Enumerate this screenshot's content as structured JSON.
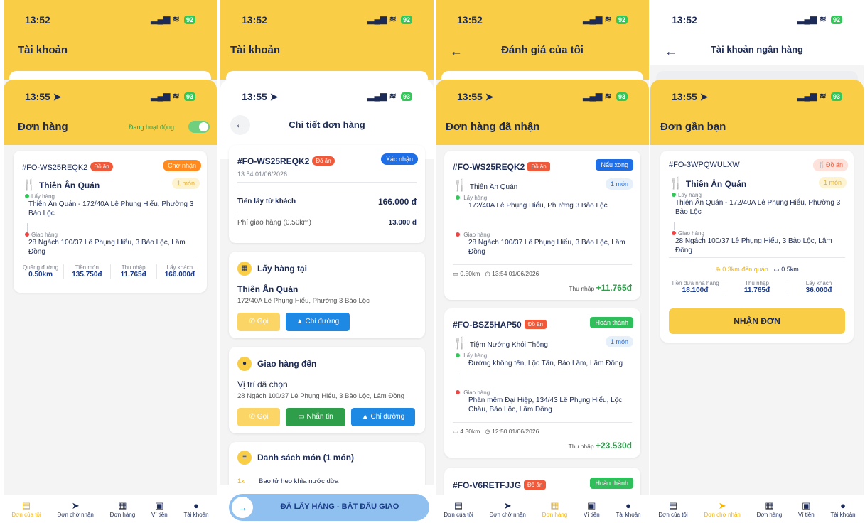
{
  "p1": {
    "bg_time": "13:52",
    "bg_title": "Tài khoản",
    "time": "13:55",
    "battery_bg": "92",
    "battery": "93",
    "title": "Đơn hàng",
    "toggle_label": "Đang hoạt động",
    "order": {
      "code": "#FO-WS25REQK2",
      "tag": "Đồ ăn",
      "status": "Chờ nhận",
      "restaurant": "Thiên Ân Quán",
      "items": "1 món",
      "pickup_label": "Lấy hàng",
      "pickup": "Thiên Ân Quán - 172/40A Lê Phụng Hiểu, Phường 3 Bảo Lộc",
      "delivery_label": "Giao hàng",
      "delivery": "28 Ngách 100/37 Lê Phụng Hiểu, 3 Bảo Lộc, Lâm Đồng",
      "stats": [
        {
          "label": "Quãng đường",
          "value": "0.50km"
        },
        {
          "label": "Tiền món",
          "value": "135.750đ"
        },
        {
          "label": "Thu nhập",
          "value": "11.765đ"
        },
        {
          "label": "Lấy khách",
          "value": "166.000đ"
        }
      ]
    }
  },
  "p2": {
    "bg_time": "13:52",
    "bg_title": "Tài khoản",
    "time": "13:55",
    "title": "Chi tiết đơn hàng",
    "code": "#FO-WS25REQK2",
    "tag": "Đồ ăn",
    "confirm": "Xác nhận",
    "datetime": "13:54 01/06/2026",
    "collect_label": "Tiền lấy từ khách",
    "collect_value": "166.000 đ",
    "fee_label": "Phí giao hàng (0.50km)",
    "fee_value": "13.000 đ",
    "pickup_section": "Lấy hàng tại",
    "pickup_name": "Thiên Ân Quán",
    "pickup_addr": "172/40A Lê Phụng Hiểu, Phường 3 Bảo Lộc",
    "call": "Gọi",
    "directions": "Chỉ đường",
    "delivery_section": "Giao hàng đến",
    "delivery_name": "Vị trí đã chọn",
    "delivery_addr": "28 Ngách 100/37 Lê Phụng Hiểu, 3 Bảo Lộc, Lâm Đồng",
    "message": "Nhắn tin",
    "list_section": "Danh sách món (1 món)",
    "item_qty": "1x",
    "item_name": "Bao tử heo khìa nước dừa",
    "action": "ĐÃ LẤY HÀNG - BẮT ĐẦU GIAO"
  },
  "p3": {
    "bg_time": "13:52",
    "bg_title": "Đánh giá của tôi",
    "time": "13:55",
    "title": "Đơn hàng đã nhận",
    "orders": [
      {
        "code": "#FO-WS25REQK2",
        "tag": "Đồ ăn",
        "status": "Nấu xong",
        "restaurant": "Thiên Ân Quán",
        "items": "1 món",
        "pickup_label": "Lấy hàng",
        "pickup": "172/40A Lê Phụng Hiểu, Phường 3 Bảo Lộc",
        "delivery_label": "Giao hàng",
        "delivery": "28 Ngách 100/37 Lê Phụng Hiểu, 3 Bảo Lộc, Lâm Đồng",
        "distance": "0.50km",
        "datetime": "13:54 01/06/2026",
        "income_label": "Thu nhập",
        "income": "+11.765đ"
      },
      {
        "code": "#FO-BSZ5HAP50",
        "tag": "Đồ ăn",
        "status": "Hoàn thành",
        "restaurant": "Tiệm Nướng Khói Thông",
        "items": "1 món",
        "pickup_label": "Lấy hàng",
        "pickup": "Đường không tên, Lộc Tân, Bảo Lâm, Lâm Đồng",
        "delivery_label": "Giao hàng",
        "delivery": "Phần mềm Đại Hiệp, 134/43 Lê Phụng Hiểu, Lộc Châu, Bảo Lộc, Lâm Đồng",
        "distance": "4.30km",
        "datetime": "12:50 01/06/2026",
        "income_label": "Thu nhập",
        "income": "+23.530đ"
      },
      {
        "code": "#FO-V6RETFJJG",
        "tag": "Đồ ăn",
        "status": "Hoàn thành"
      }
    ]
  },
  "p4": {
    "bg_time": "13:52",
    "bg_title": "Tài khoản ngân hàng",
    "time": "13:55",
    "title": "Đơn gần bạn",
    "order": {
      "code": "#FO-3WPQWULXW",
      "tag": "Đồ ăn",
      "restaurant": "Thiên Ân Quán",
      "items": "1 món",
      "pickup_label": "Lấy hàng",
      "pickup": "Thiên Ân Quán - 172/40A Lê Phụng Hiểu, Phường 3 Bảo Lộc",
      "delivery_label": "Giao hàng",
      "delivery": "28 Ngách 100/37 Lê Phụng Hiểu, 3 Bảo Lộc, Lâm Đồng",
      "to_shop": "0.3km đến quán",
      "distance": "0.5km",
      "stats": [
        {
          "label": "Tiền đưa nhà hàng",
          "value": "18.100đ"
        },
        {
          "label": "Thu nhập",
          "value": "11.765đ"
        },
        {
          "label": "Lấy khách",
          "value": "36.000đ"
        }
      ],
      "accept": "NHẬN ĐƠN"
    }
  },
  "nav": [
    "Đơn của tôi",
    "Đơn chờ nhận",
    "Đơn hàng",
    "Ví tiền",
    "Tài khoản"
  ],
  "colors": {
    "accent": "#f9cd46",
    "navy": "#1b2a57",
    "green": "#33c759",
    "blue": "#1e88e5"
  }
}
